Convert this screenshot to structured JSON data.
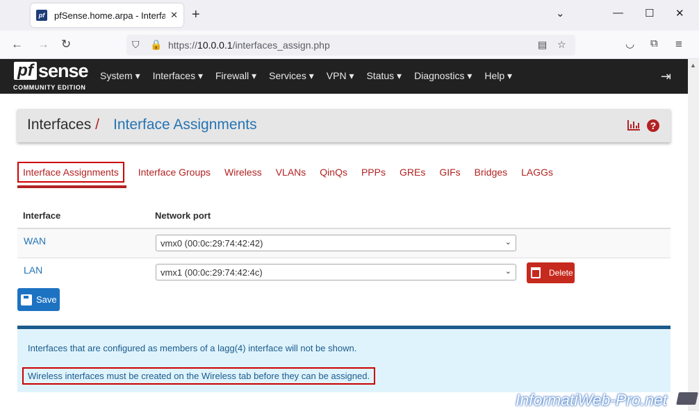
{
  "browser": {
    "tab_title": "pfSense.home.arpa - Interfaces",
    "url_scheme": "https://",
    "url_host": "10.0.0.1",
    "url_path": "/interfaces_assign.php"
  },
  "brand": {
    "logo_pf": "pf",
    "logo_sense": "sense",
    "edition": "COMMUNITY EDITION"
  },
  "menu": [
    "System ▾",
    "Interfaces ▾",
    "Firewall ▾",
    "Services ▾",
    "VPN ▾",
    "Status ▾",
    "Diagnostics ▾",
    "Help ▾"
  ],
  "breadcrumb": {
    "parent": "Interfaces",
    "separator": "/",
    "current": "Interface Assignments"
  },
  "tabs": [
    "Interface Assignments",
    "Interface Groups",
    "Wireless",
    "VLANs",
    "QinQs",
    "PPPs",
    "GREs",
    "GIFs",
    "Bridges",
    "LAGGs"
  ],
  "table": {
    "headers": [
      "Interface",
      "Network port"
    ],
    "rows": [
      {
        "interface": "WAN",
        "port": "vmx0 (00:0c:29:74:42:42)"
      },
      {
        "interface": "LAN",
        "port": "vmx1 (00:0c:29:74:42:4c)",
        "delete_label": "Delete"
      }
    ]
  },
  "save_label": "Save",
  "info": {
    "line1": "Interfaces that are configured as members of a lagg(4) interface will not be shown.",
    "line2": "Wireless interfaces must be created on the Wireless tab before they can be assigned."
  },
  "watermark": "InformatiWeb-Pro.net",
  "colors": {
    "accent": "#b22222",
    "link": "#2574b4",
    "save": "#1d73c2",
    "danger": "#c62a1e"
  }
}
